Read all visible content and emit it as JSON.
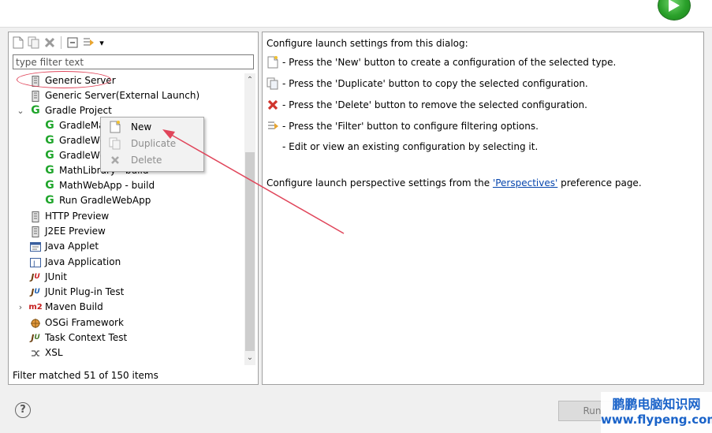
{
  "toolbar": {
    "buttons": [
      {
        "name": "new-config-icon"
      },
      {
        "name": "duplicate-config-icon"
      },
      {
        "name": "delete-config-icon"
      },
      {
        "name": "collapse-all-icon"
      },
      {
        "name": "filter-icon"
      },
      {
        "name": "dropdown-arrow-icon",
        "glyph": "▾"
      }
    ]
  },
  "filter": {
    "placeholder": "type filter text"
  },
  "tree": {
    "items": [
      {
        "label": "Generic Server",
        "icon": "server-icon"
      },
      {
        "label": "Generic Server(External Launch)",
        "icon": "server-icon"
      },
      {
        "label": "Gradle Project",
        "icon": "gradle-icon",
        "expanded": "⌄"
      },
      {
        "label": "GradleMa",
        "icon": "gradle-icon"
      },
      {
        "label": "GradleWe",
        "icon": "gradle-icon"
      },
      {
        "label": "GradleWe",
        "icon": "gradle-icon"
      },
      {
        "label": "MathLibrary - build",
        "icon": "gradle-icon"
      },
      {
        "label": "MathWebApp - build",
        "icon": "gradle-icon"
      },
      {
        "label": "Run GradleWebApp",
        "icon": "gradle-icon"
      },
      {
        "label": "HTTP Preview",
        "icon": "server-icon"
      },
      {
        "label": "J2EE Preview",
        "icon": "server-icon"
      },
      {
        "label": "Java Applet",
        "icon": "java-applet-icon"
      },
      {
        "label": "Java Application",
        "icon": "java-app-icon"
      },
      {
        "label": "JUnit",
        "icon": "junit-icon"
      },
      {
        "label": "JUnit Plug-in Test",
        "icon": "junit-plugin-icon"
      },
      {
        "label": "Maven Build",
        "icon": "maven-icon",
        "collapsed": "›"
      },
      {
        "label": "OSGi Framework",
        "icon": "osgi-icon"
      },
      {
        "label": "Task Context Test",
        "icon": "junit-icon"
      },
      {
        "label": "XSL",
        "icon": "xsl-icon"
      }
    ]
  },
  "status": "Filter matched 51 of 150 items",
  "context_menu": {
    "items": [
      {
        "label": "New",
        "enabled": "yes"
      },
      {
        "label": "Duplicate",
        "enabled": "no"
      },
      {
        "label": "Delete",
        "enabled": "no"
      }
    ]
  },
  "right": {
    "intro": "Configure launch settings from this dialog:",
    "lines": [
      "- Press the 'New' button to create a configuration of the selected type.",
      "- Press the 'Duplicate' button to copy the selected configuration.",
      "- Press the 'Delete' button to remove the selected configuration.",
      "- Press the 'Filter' button to configure filtering options.",
      "- Edit or view an existing configuration by selecting it."
    ],
    "perspective_prefix": "Configure launch perspective settings from the ",
    "perspective_link": "'Perspectives'",
    "perspective_suffix": " preference page."
  },
  "footer": {
    "help": "?",
    "run": "Run"
  },
  "watermark": {
    "line1": "鹏鹏电脑知识网",
    "line2": "www.flypeng.com"
  },
  "colors": {
    "gradle": "#1fa52b",
    "delete": "#d0342c",
    "arrow": "#e0455a",
    "link": "#0645ad"
  }
}
